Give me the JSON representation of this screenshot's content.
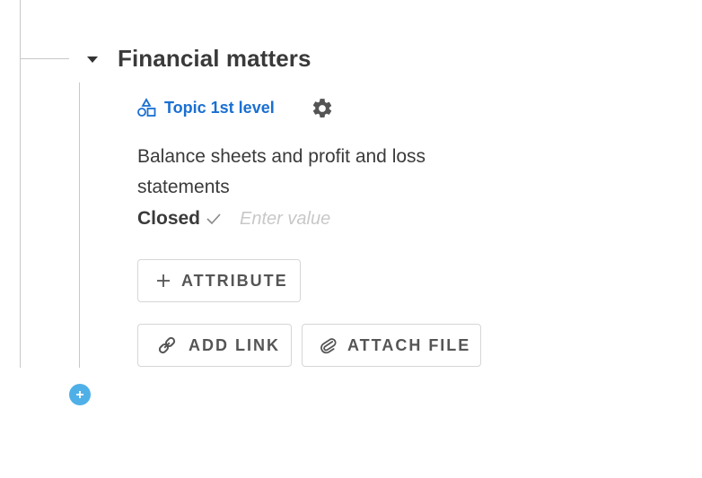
{
  "node": {
    "title": "Financial matters",
    "topic_label": "Topic 1st level",
    "description": "Balance sheets and profit and loss statements",
    "status_label": "Closed",
    "value_placeholder": "Enter value"
  },
  "buttons": {
    "attribute": "ATTRIBUTE",
    "add_link": "ADD LINK",
    "attach_file": "ATTACH FILE"
  },
  "colors": {
    "topic_blue": "#1a6fd1",
    "add_circle": "#4fb0e8"
  }
}
